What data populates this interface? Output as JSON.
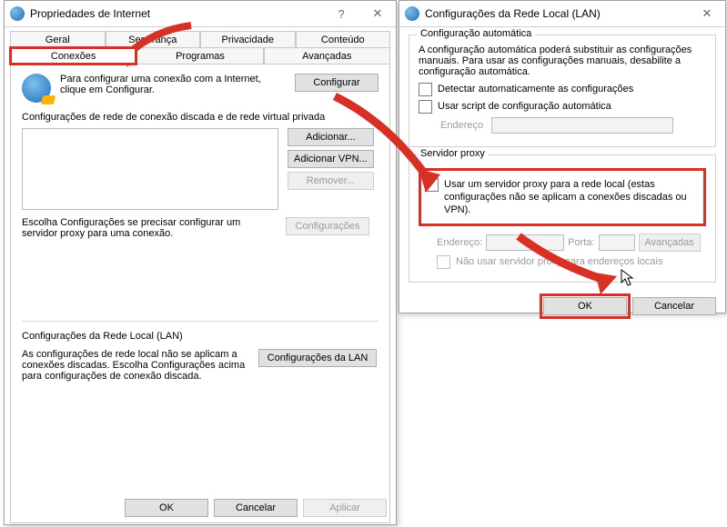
{
  "win1": {
    "title": "Propriedades de Internet",
    "tabs_row1": [
      "Geral",
      "Segurança",
      "Privacidade",
      "Conteúdo"
    ],
    "tabs_row2": [
      "Conexões",
      "Programas",
      "Avançadas"
    ],
    "intro_text": "Para configurar uma conexão com a Internet, clique em Configurar.",
    "btn_configurar": "Configurar",
    "dial_label": "Configurações de rede de conexão discada e de rede virtual privada",
    "btn_adicionar": "Adicionar...",
    "btn_adicionar_vpn": "Adicionar VPN...",
    "btn_remover": "Remover...",
    "btn_configuracoes": "Configurações",
    "dial_help": "Escolha Configurações se precisar configurar um servidor proxy para uma conexão.",
    "lan_heading": "Configurações da Rede Local (LAN)",
    "lan_help": "As configurações de rede local não se aplicam a conexões discadas. Escolha Configurações acima para configurações de conexão discada.",
    "btn_lan": "Configurações da LAN",
    "btn_ok": "OK",
    "btn_cancel": "Cancelar",
    "btn_apply": "Aplicar"
  },
  "win2": {
    "title": "Configurações da Rede Local (LAN)",
    "group_auto": "Configuração automática",
    "auto_desc": "A configuração automática poderá substituir as configurações manuais. Para usar as configurações manuais, desabilite a configuração automática.",
    "chk_auto_detect": "Detectar automaticamente as configurações",
    "chk_script": "Usar script de configuração automática",
    "lbl_endereco": "Endereço",
    "group_proxy": "Servidor proxy",
    "chk_proxy": "Usar um servidor proxy para a rede local (estas configurações não se aplicam a conexões discadas ou VPN).",
    "lbl_endereco2": "Endereço:",
    "lbl_porta": "Porta:",
    "btn_avancadas": "Avançadas",
    "chk_bypass": "Não usar servidor proxy para endereços locais",
    "btn_ok": "OK",
    "btn_cancel": "Cancelar"
  }
}
